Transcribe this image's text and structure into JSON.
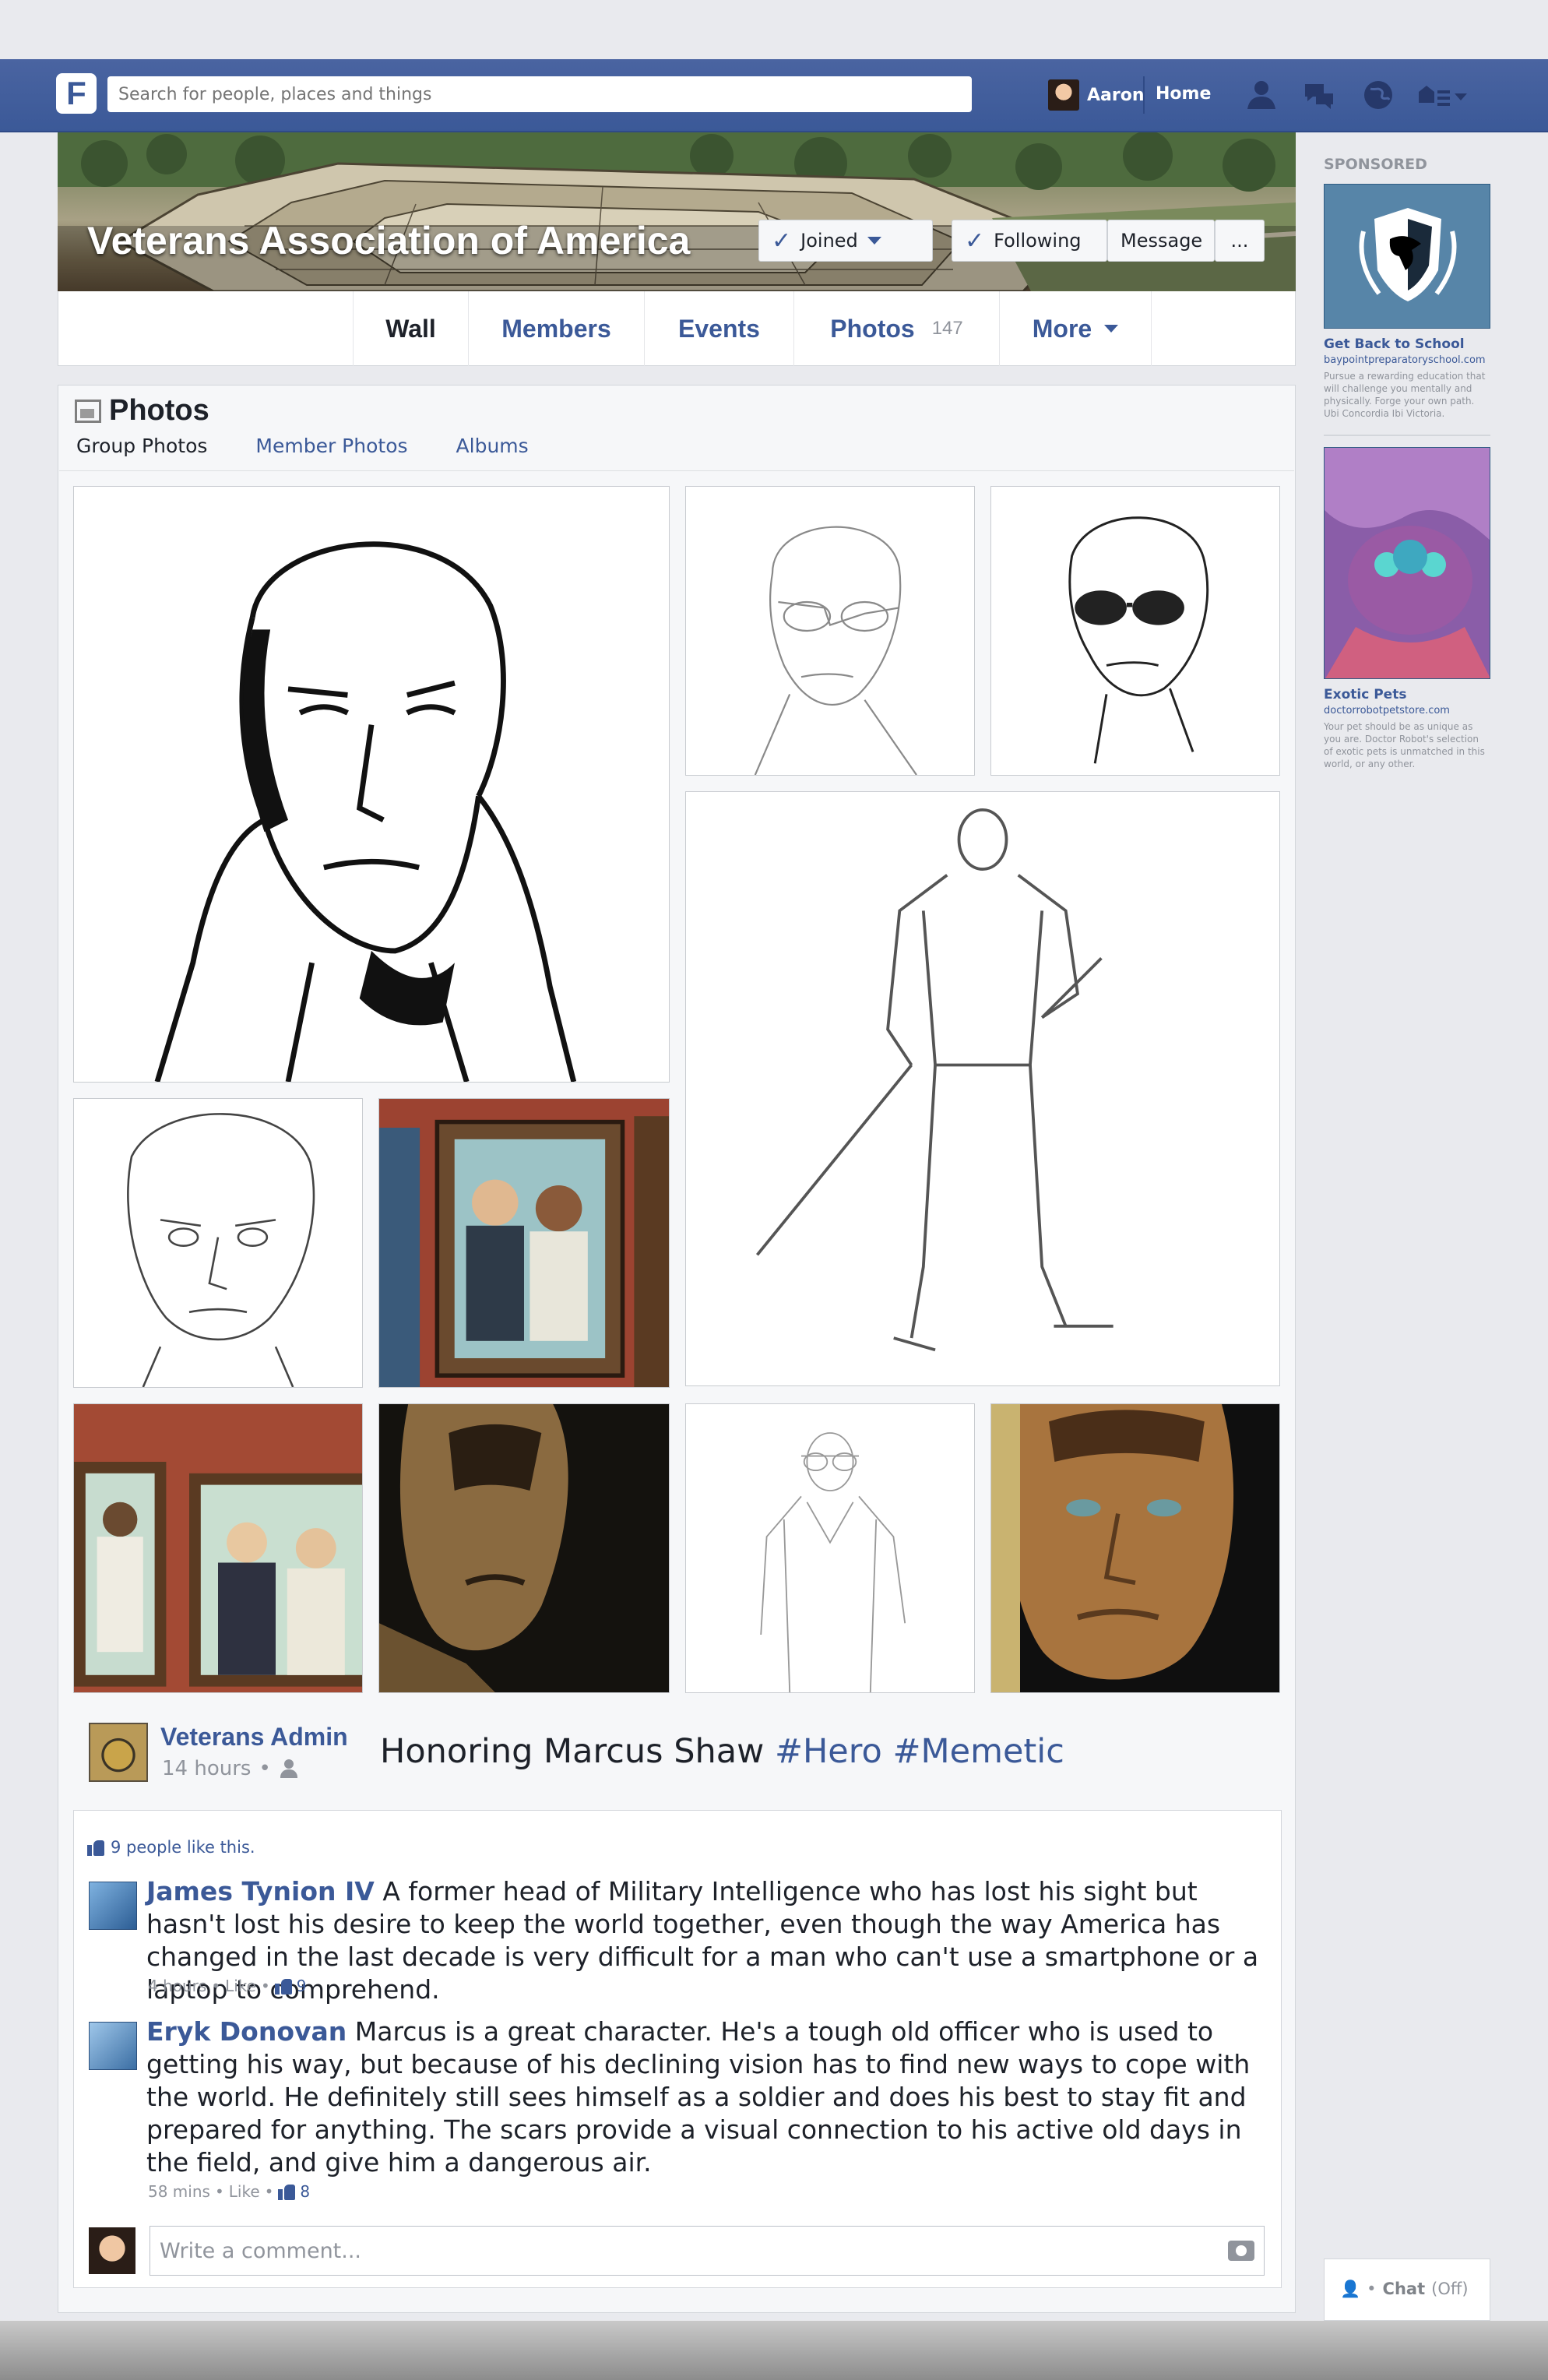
{
  "topbar": {
    "logo": "F",
    "search_placeholder": "Search for people, places and things",
    "user_name": "Aaron",
    "home_label": "Home",
    "icons": [
      "friends-icon",
      "messages-icon",
      "globe-icon",
      "settings-icon"
    ]
  },
  "group": {
    "title": "Veterans Association of America",
    "joined_label": "Joined",
    "following_label": "Following",
    "message_label": "Message",
    "more_label": "..."
  },
  "tabs": [
    {
      "label": "Wall",
      "active": true
    },
    {
      "label": "Members"
    },
    {
      "label": "Events"
    },
    {
      "label": "Photos",
      "count": "147"
    },
    {
      "label": "More"
    }
  ],
  "photos": {
    "heading": "Photos",
    "subtabs": [
      "Group Photos",
      "Member Photos",
      "Albums"
    ]
  },
  "post": {
    "author": "Veterans Admin",
    "time": "14 hours",
    "text": "Honoring Marcus Shaw",
    "tags": [
      "#Hero",
      "#Memetic"
    ],
    "likes": "9 people like this."
  },
  "comments": [
    {
      "name": "James Tynion IV",
      "text": "A former head of Military Intelligence who has lost his sight but hasn't lost his desire to keep the world together, even though the way America has changed in the last decade is very difficult for a man who can't use a smartphone or a laptop to comprehend.",
      "time": "4 hours",
      "like_label": "Like",
      "likes": "9"
    },
    {
      "name": "Eryk Donovan",
      "text": "Marcus is a great character. He's a tough old officer who is used to getting his way, but because of his declining vision has to find new ways to cope with the world. He definitely still sees himself as a soldier and does his best to stay fit and prepared for anything. The scars provide a visual connection to his active old days in the field, and give him a dangerous air.",
      "time": "58 mins",
      "like_label": "Like",
      "likes": "8"
    }
  ],
  "write_comment_placeholder": "Write a comment...",
  "sidebar": {
    "sponsored": "SPONSORED",
    "ads": [
      {
        "title": "Get Back to School",
        "url": "baypointpreparatoryschool.com",
        "desc": "Pursue a rewarding education that will challenge you mentally and physically. Forge your own path. Ubi Concordia Ibi Victoria."
      },
      {
        "title": "Exotic Pets",
        "url": "doctorrobotpetstore.com",
        "desc": "Your pet should be as unique as you are. Doctor Robot's selection of exotic pets is unmatched in this world, or any other."
      }
    ],
    "chat_label": "Chat",
    "chat_status": "(Off)"
  },
  "colors": {
    "brand": "#3b5998",
    "topbar": "#4a64a1",
    "background": "#e9eaee"
  }
}
